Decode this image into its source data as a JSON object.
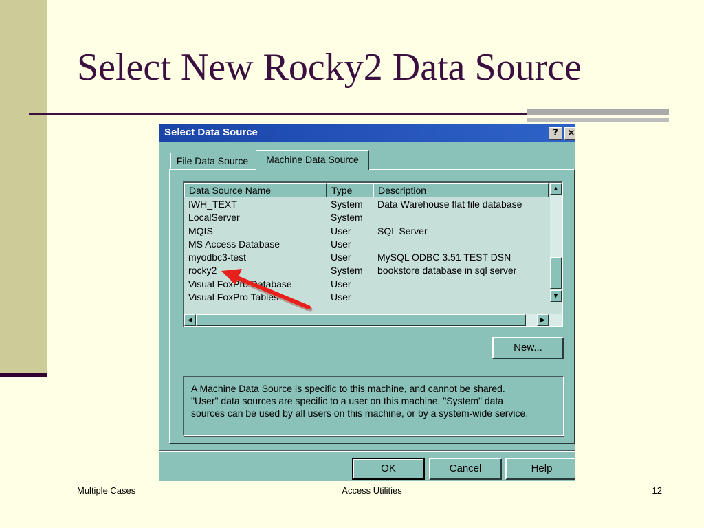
{
  "slide": {
    "title": "Select New Rocky2 Data Source",
    "footer_left": "Multiple Cases",
    "footer_center": "Access Utilities",
    "page_number": "12"
  },
  "dialog": {
    "title": "Select Data Source",
    "help_icon": "?",
    "close_icon": "×",
    "tabs": [
      "File Data Source",
      "Machine Data Source"
    ],
    "active_tab": "Machine Data Source",
    "columns": [
      "Data Source Name",
      "Type",
      "Description"
    ],
    "rows": [
      {
        "name": "IWH_TEXT",
        "type": "System",
        "desc": "Data Warehouse flat file database"
      },
      {
        "name": "LocalServer",
        "type": "System",
        "desc": ""
      },
      {
        "name": "MQIS",
        "type": "User",
        "desc": "SQL Server"
      },
      {
        "name": "MS Access Database",
        "type": "User",
        "desc": ""
      },
      {
        "name": "myodbc3-test",
        "type": "User",
        "desc": "MySQL ODBC 3.51 TEST DSN"
      },
      {
        "name": "rocky2",
        "type": "System",
        "desc": "bookstore database in sql server"
      },
      {
        "name": "Visual FoxPro Database",
        "type": "User",
        "desc": ""
      },
      {
        "name": "Visual FoxPro Tables",
        "type": "User",
        "desc": ""
      }
    ],
    "new_button": "New...",
    "info_text": "A Machine Data Source is specific to this machine, and cannot be shared.\n\"User\" data sources are specific to a user on this machine.  \"System\" data\nsources can be used by all users on this machine, or by a system-wide service.",
    "ok_button": "OK",
    "cancel_button": "Cancel",
    "help_button": "Help",
    "scroll_up_icon": "▲",
    "scroll_down_icon": "▼",
    "scroll_left_icon": "◀",
    "scroll_right_icon": "▶"
  },
  "colors": {
    "slide_background": "#FFFFE5",
    "title_color": "#3B0F40",
    "dialog_background": "#8AC1B8",
    "titlebar": "#1A44A8",
    "annotation_arrow": "#E8201C"
  }
}
